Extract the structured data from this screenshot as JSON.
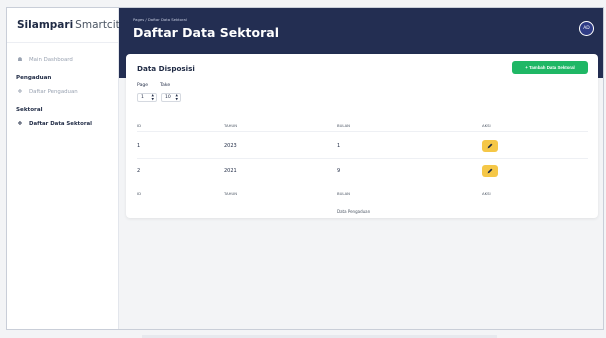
{
  "brand": {
    "bold": "Silampari",
    "light": "Smartcity"
  },
  "sidebar": {
    "main_dashboard": {
      "label": "Main Dashboard",
      "icon": "home-icon"
    },
    "sections": [
      {
        "title": "Pengaduan",
        "item": {
          "label": "Daftar Pengaduan",
          "icon": "info-icon",
          "active": false
        }
      },
      {
        "title": "Sektoral",
        "item": {
          "label": "Daftar Data Sektoral",
          "icon": "info-icon",
          "active": true
        }
      }
    ]
  },
  "header": {
    "breadcrumb": "Pages / Daftar Data Sektoral",
    "title": "Daftar Data Sektoral",
    "avatar_initials": "AD"
  },
  "card": {
    "title": "Data Disposisi",
    "add_button": "+ Tambah Data Sektoral",
    "page_label": "Page",
    "take_label": "Take",
    "page_value": "1",
    "take_value": "10",
    "columns": [
      "ID",
      "TAHUN",
      "BULAN",
      "AKSI"
    ],
    "rows": [
      {
        "id": "1",
        "tahun": "2023",
        "bulan": "1"
      },
      {
        "id": "2",
        "tahun": "2021",
        "bulan": "9"
      }
    ],
    "footer_columns": [
      "ID",
      "TAHUN",
      "BULAN",
      "AKSI"
    ],
    "footer_note": "Data Pengaduan"
  },
  "colors": {
    "topbar": "#232e52",
    "add_button": "#1fb765",
    "edit_button": "#f5c747"
  }
}
